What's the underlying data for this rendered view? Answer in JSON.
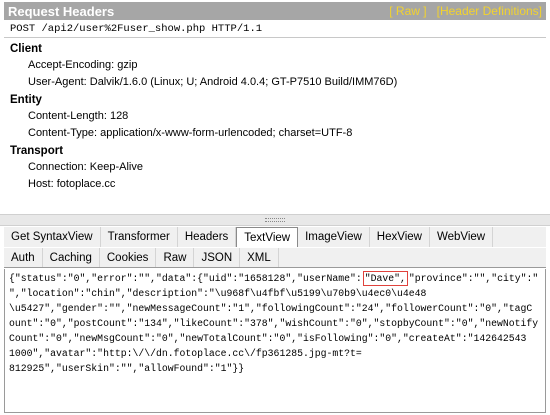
{
  "request_headers": {
    "title": "Request Headers",
    "raw_link": "[ Raw ]",
    "definitions_link": "[Header Definitions]",
    "request_line": "POST /api2/user%2Fuser_show.php HTTP/1.1",
    "groups": [
      {
        "title": "Client",
        "items": [
          "Accept-Encoding: gzip",
          "User-Agent: Dalvik/1.6.0 (Linux; U; Android 4.0.4; GT-P7510 Build/IMM76D)"
        ]
      },
      {
        "title": "Entity",
        "items": [
          "Content-Length: 128",
          "Content-Type: application/x-www-form-urlencoded; charset=UTF-8"
        ]
      },
      {
        "title": "Transport",
        "items": [
          "Connection: Keep-Alive",
          "Host: fotoplace.cc"
        ]
      }
    ]
  },
  "response_tabs": {
    "row1": [
      "Get SyntaxView",
      "Transformer",
      "Headers",
      "TextView",
      "ImageView",
      "HexView",
      "WebView"
    ],
    "row2": [
      "Auth",
      "Caching",
      "Cookies",
      "Raw",
      "JSON",
      "XML"
    ],
    "active": "TextView"
  },
  "text_view": {
    "line1_before": "{\"status\":\"0\",\"error\":\"\",\"data\":{\"uid\":\"1658128\",\"userName\":",
    "line1_highlight": "\"Dave\",",
    "line1_after": "\"province\":\"\",\"city\":\"",
    "lines": [
      "\",\"location\":\"chin\",\"description\":\"\\u968f\\u4fbf\\u5199\\u70b9\\u4ec0\\u4e48",
      "\\u5427\",\"gender\":\"\",\"newMessageCount\":\"1\",\"followingCount\":\"24\",\"followerCount\":\"0\",\"tagC",
      "ount\":\"0\",\"postCount\":\"134\",\"likeCount\":\"378\",\"wishCount\":\"0\",\"stopbyCount\":\"0\",\"newNotify",
      "Count\":\"0\",\"newMsgCount\":\"0\",\"newTotalCount\":\"0\",\"isFollowing\":\"0\",\"createAt\":\"142642543",
      "1000\",\"avatar\":\"http:\\/\\/dn.fotoplace.cc\\/fp361285.jpg-mt?t=",
      "812925\",\"userSkin\":\"\",\"allowFound\":\"1\"}}"
    ]
  }
}
